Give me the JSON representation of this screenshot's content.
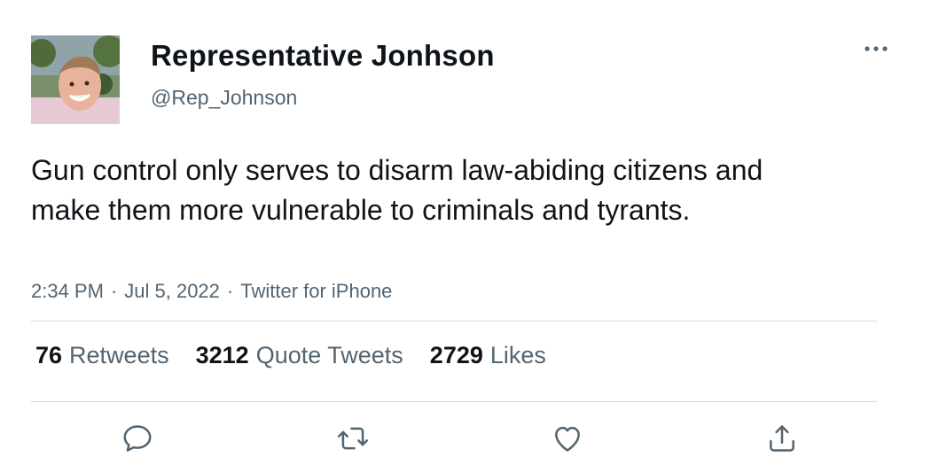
{
  "author": {
    "display_name": "Representative Jonhson",
    "handle": "@Rep_Johnson"
  },
  "tweet": {
    "text": "Gun control only serves to disarm law-abiding citizens and make them more vulnerable to criminals and tyrants.",
    "time": "2:34 PM",
    "separator": "·",
    "date": "Jul 5, 2022",
    "source": "Twitter for iPhone"
  },
  "stats": {
    "retweets_count": "76",
    "retweets_label": "Retweets",
    "quotes_count": "3212",
    "quotes_label": "Quote Tweets",
    "likes_count": "2729",
    "likes_label": "Likes"
  },
  "icons": {
    "more": "more-dots-icon",
    "reply": "reply-icon",
    "retweet": "retweet-icon",
    "like": "heart-icon",
    "share": "share-icon"
  },
  "colors": {
    "text_primary": "#0f1419",
    "text_secondary": "#536471",
    "divider": "#cfd9de"
  }
}
